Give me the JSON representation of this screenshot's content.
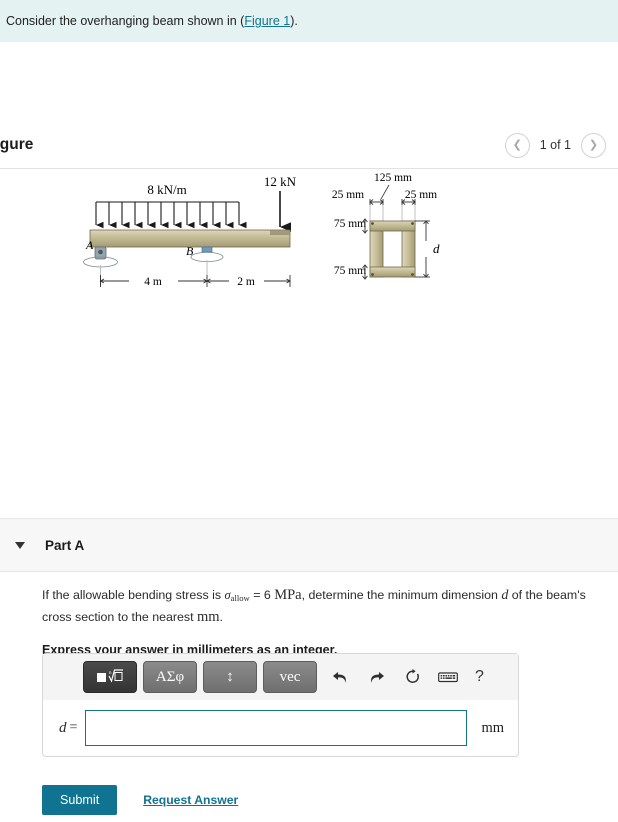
{
  "intro": {
    "text_before": "Consider the overhanging beam shown in (",
    "link_label": "Figure 1",
    "text_after": ")."
  },
  "figure": {
    "title": "Figure",
    "pager": {
      "prev_icon": "chevron-left-icon",
      "label": "1 of 1",
      "next_icon": "chevron-right-icon"
    },
    "beam": {
      "distributed_load": "8 kN/m",
      "point_load": "12 kN",
      "support_a": "A",
      "support_b": "B",
      "span_ab": "4 m",
      "span_overhang": "2 m"
    },
    "cross_section": {
      "total_width": "125 mm",
      "flange_left": "25 mm",
      "flange_right": "25 mm",
      "top_thickness": "75 mm",
      "bottom_thickness": "75 mm",
      "depth_label": "d"
    }
  },
  "part": {
    "caret_icon": "caret-down-icon",
    "title": "Part A",
    "question": {
      "seg1": "If the allowable bending stress is ",
      "sigma": "σ",
      "sigma_sub": "allow",
      "seg2": " = 6 ",
      "unit_mpa": "MPa",
      "seg3": ", determine the minimum dimension ",
      "var_d": "d",
      "seg4": " of the beam's cross section to the nearest ",
      "unit_mm": "mm",
      "seg5": "."
    },
    "instruction": "Express your answer in millimeters as an integer."
  },
  "answer": {
    "toolbar": {
      "template_label": "■√□",
      "greek_label": "ΑΣφ",
      "updown_label": "↕",
      "vec_label": "vec",
      "undo_icon": "undo-arrow-icon",
      "redo_icon": "redo-arrow-icon",
      "reset_icon": "reset-circle-icon",
      "keyboard_icon": "keyboard-icon",
      "help_label": "?"
    },
    "var_label": "d",
    "equals": "=",
    "value": "",
    "placeholder": "",
    "unit": "mm"
  },
  "footer": {
    "submit_label": "Submit",
    "request_answer_label": "Request Answer"
  },
  "colors": {
    "banner_bg": "#e4f2f1",
    "accent": "#0f7391",
    "wood": "#c8c09a",
    "wood_dark": "#9a926e"
  }
}
